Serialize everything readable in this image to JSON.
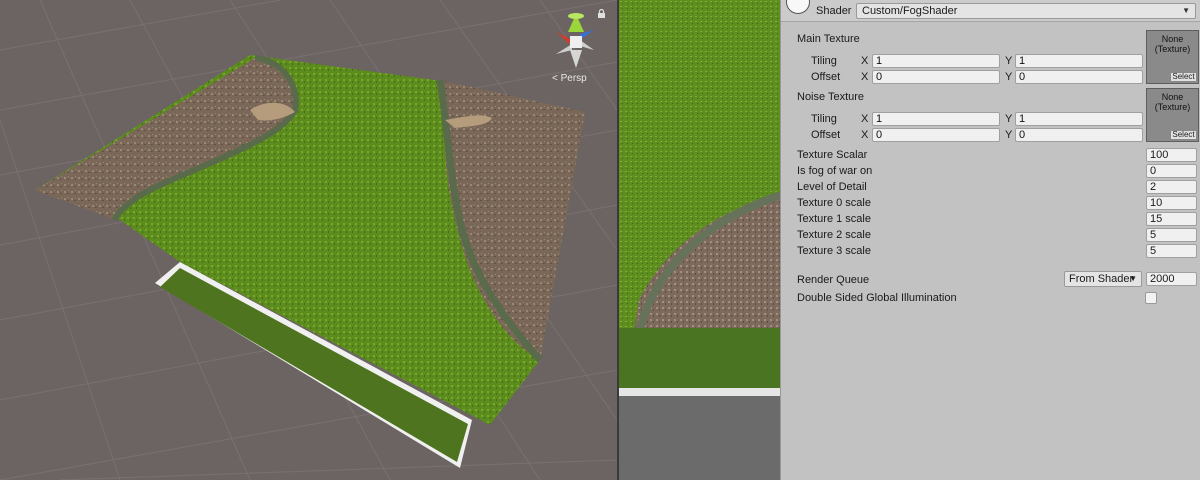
{
  "scene": {
    "projection_label": "< Persp"
  },
  "inspector": {
    "shader_label": "Shader",
    "shader_value": "Custom/FogShader",
    "main_texture": {
      "title": "Main Texture",
      "tiling_label": "Tiling",
      "offset_label": "Offset",
      "x_label": "X",
      "y_label": "Y",
      "tiling_x": "1",
      "tiling_y": "1",
      "offset_x": "0",
      "offset_y": "0",
      "slot_text": "None\n(Texture)",
      "select_label": "Select"
    },
    "noise_texture": {
      "title": "Noise Texture",
      "tiling_label": "Tiling",
      "offset_label": "Offset",
      "x_label": "X",
      "y_label": "Y",
      "tiling_x": "1",
      "tiling_y": "1",
      "offset_x": "0",
      "offset_y": "0",
      "slot_text": "None\n(Texture)",
      "select_label": "Select"
    },
    "properties": [
      {
        "label": "Texture Scalar",
        "value": "100"
      },
      {
        "label": "Is fog of war on",
        "value": "0"
      },
      {
        "label": "Level of Detail",
        "value": "2"
      },
      {
        "label": "Texture 0 scale",
        "value": "10"
      },
      {
        "label": "Texture 1 scale",
        "value": "15"
      },
      {
        "label": "Texture 2 scale",
        "value": "5"
      },
      {
        "label": "Texture 3 scale",
        "value": "5"
      }
    ],
    "render_queue": {
      "label": "Render Queue",
      "mode": "From Shader",
      "value": "2000"
    },
    "double_sided_gi": {
      "label": "Double Sided Global Illumination",
      "checked": false
    }
  },
  "colors": {
    "grass": "#5f8f1f",
    "dirt": "#7d6a5a",
    "scene_bg": "#6c6462",
    "inspector_bg": "#c2c2c2"
  }
}
